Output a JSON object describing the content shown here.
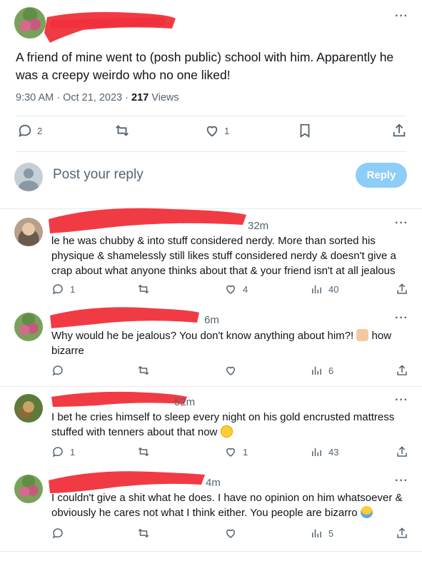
{
  "main_tweet": {
    "text": "A friend of mine went to (posh public) school with him. Apparently he was a creepy weirdo who no one liked!",
    "time": "9:30 AM · Oct 21, 2023 · ",
    "views_count": "217",
    "views_label": " Views",
    "replies": "2",
    "retweets": "",
    "likes": "1"
  },
  "composer": {
    "placeholder": "Post your reply",
    "button": "Reply"
  },
  "replies": [
    {
      "time": "32m",
      "text": "le he was chubby & into stuff considered nerdy. More than sorted his physique & shamelessly still likes stuff considered nerdy & doesn't give a crap about what anyone thinks about that & your friend isn't at all jealous",
      "replies": "1",
      "retweets": "",
      "likes": "4",
      "views": "40"
    },
    {
      "time": "6m",
      "text": "Why would he be jealous? You don't know anything about him?!",
      "text_after": " how bizarre",
      "emoji": "man-shrugging",
      "replies": "",
      "retweets": "",
      "likes": "",
      "views": "6"
    },
    {
      "time": "52m",
      "text": "I bet he cries himself to sleep every night on his gold encrusted mattress stuffed with tenners about that now",
      "emoji": "smirking-face",
      "replies": "1",
      "retweets": "",
      "likes": "1",
      "views": "43"
    },
    {
      "time": "4m",
      "text": "I couldn't give a shit what he does. I have no opinion on him whatsoever & obviously he cares not what I think either. You people are bizarro",
      "emoji": "tears-of-joy",
      "replies": "",
      "retweets": "",
      "likes": "",
      "views": "5"
    }
  ],
  "colors": {
    "accent": "#1d9bf0",
    "muted": "#536471",
    "redaction": "#f0303a"
  }
}
